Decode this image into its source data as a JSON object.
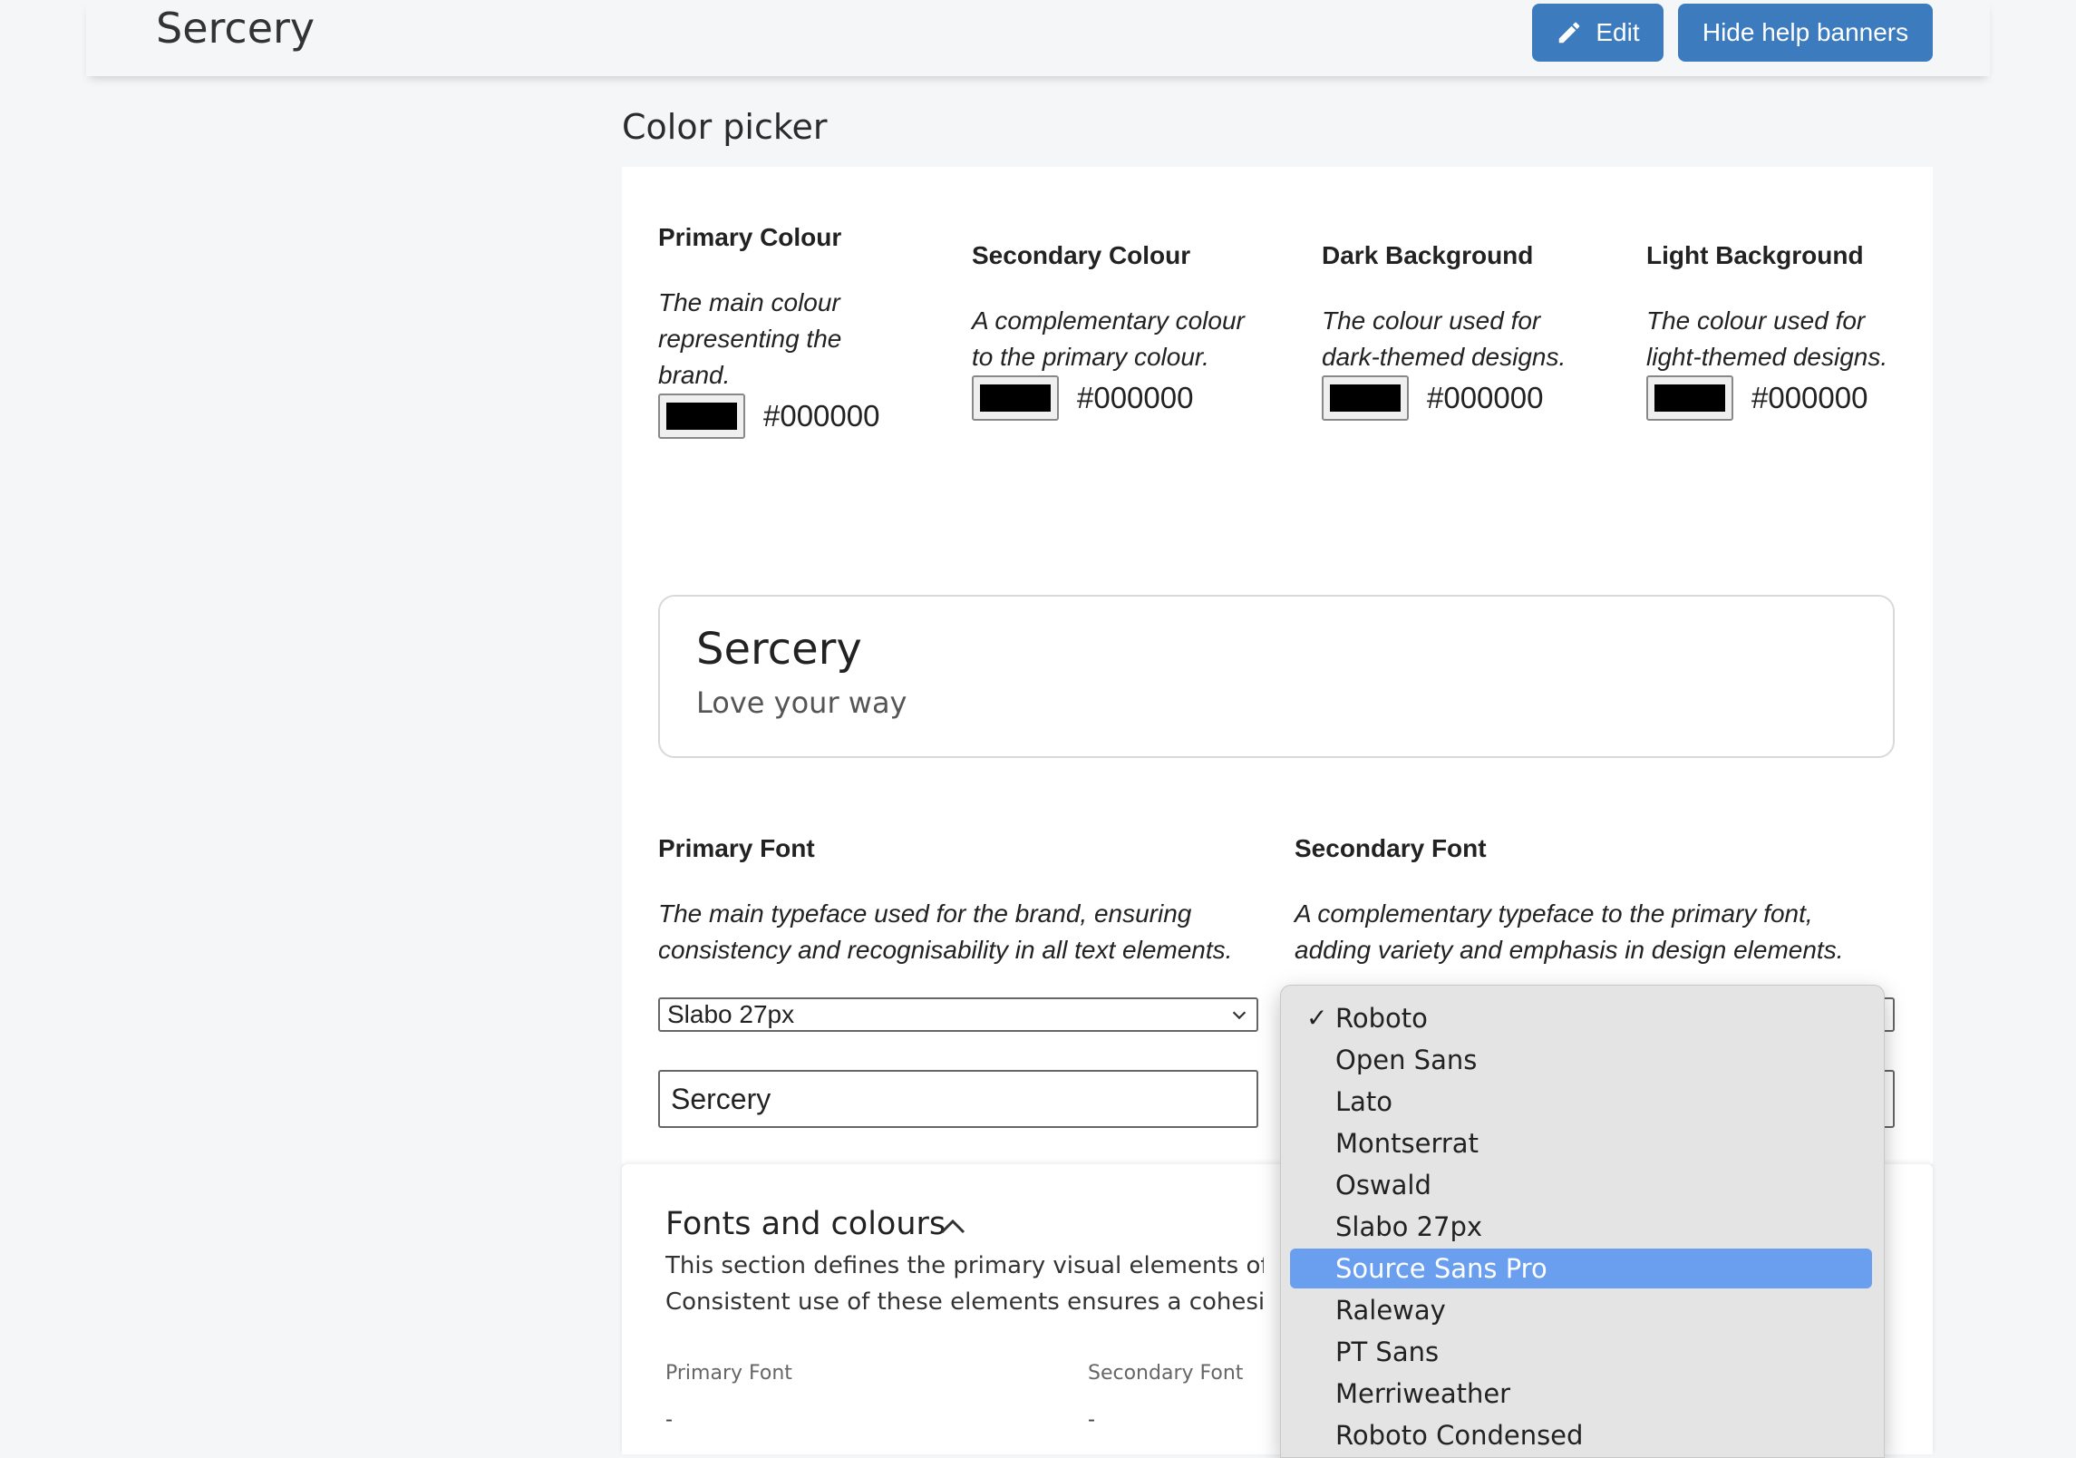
{
  "header": {
    "title": "Sercery",
    "edit_label": "Edit",
    "hide_banners_label": "Hide help banners"
  },
  "section": {
    "heading": "Color picker"
  },
  "colors": [
    {
      "title": "Primary Colour",
      "description": "The main colour representing the brand.",
      "value": "#000000"
    },
    {
      "title": "Secondary Colour",
      "description": "A complementary colour to the primary colour.",
      "value": "#000000"
    },
    {
      "title": "Dark Background",
      "description": "The colour used for dark-themed designs.",
      "value": "#000000"
    },
    {
      "title": "Light Background",
      "description": "The colour used for light-themed designs.",
      "value": "#000000"
    }
  ],
  "preview": {
    "title": "Sercery",
    "tagline": "Love your way"
  },
  "fonts": {
    "primary": {
      "title": "Primary Font",
      "description": "The main typeface used for the brand, ensuring consistency and recognisability in all text elements.",
      "selected": "Slabo 27px",
      "sample_text": "Sercery"
    },
    "secondary": {
      "title": "Secondary Font",
      "description": "A complementary typeface to the primary font, adding variety and emphasis in design elements."
    }
  },
  "dropdown": {
    "checked": "Roboto",
    "highlighted": "Source Sans Pro",
    "options": [
      "Roboto",
      "Open Sans",
      "Lato",
      "Montserrat",
      "Oswald",
      "Slabo 27px",
      "Source Sans Pro",
      "Raleway",
      "PT Sans",
      "Merriweather",
      "Roboto Condensed"
    ]
  },
  "accordion": {
    "title": "Fonts and colours",
    "description_line1": "This section defines the primary visual elements of the b",
    "description_line2": "Consistent use of these elements ensures a cohesive ar",
    "primary_font_label": "Primary Font",
    "secondary_font_label": "Secondary Font",
    "primary_font_value": "-",
    "secondary_font_value": "-"
  },
  "colors_theme": {
    "accent": "#3d7bbf",
    "highlight": "#6a9ff0"
  }
}
